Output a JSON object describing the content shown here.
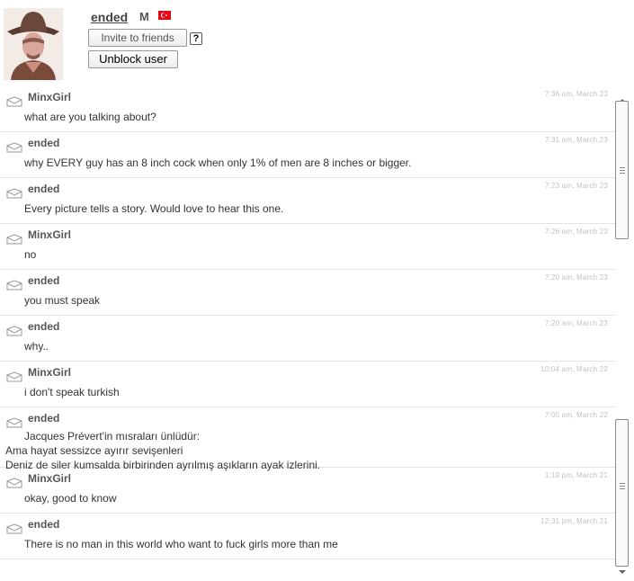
{
  "profile": {
    "username": "ended",
    "gender": "M",
    "invite_label": "Invite to friends",
    "help_label": "?",
    "unblock_label": "Unblock user",
    "flag_color": "#e30a17",
    "avatar_icon": "profile-photo-cowboy"
  },
  "messages": [
    {
      "sender": "MinxGirl",
      "time": "7:36 am, March 23",
      "lines": [
        "what are you talking about?"
      ]
    },
    {
      "sender": "ended",
      "time": "7:31 am, March 23",
      "lines": [
        "why EVERY guy has an 8 inch cock when only 1% of men are 8 inches or bigger."
      ]
    },
    {
      "sender": "ended",
      "time": "7:23 am, March 23",
      "lines": [
        "Every picture tells a story. Would love to hear this one."
      ]
    },
    {
      "sender": "MinxGirl",
      "time": "7:26 am, March 23",
      "lines": [
        "no"
      ]
    },
    {
      "sender": "ended",
      "time": "7:20 am, March 23",
      "lines": [
        "you must speak"
      ]
    },
    {
      "sender": "ended",
      "time": "7:20 am, March 23",
      "lines": [
        "why.."
      ]
    },
    {
      "sender": "MinxGirl",
      "time": "10:04 am, March 22",
      "lines": [
        "i don't speak turkish"
      ]
    },
    {
      "sender": "ended",
      "time": "7:05 am, March 22",
      "lines": [
        "Jacques Prévert'in mısraları ünlüdür:",
        "Ama hayat sessizce ayırır sevişenleri",
        "Deniz de siler kumsalda birbirinden ayrılmış aşıkların ayak izlerini."
      ]
    },
    {
      "sender": "MinxGirl",
      "time": "1:19 pm, March 21",
      "lines": [
        "okay, good to know"
      ]
    },
    {
      "sender": "ended",
      "time": "12:31 pm, March 21",
      "lines": [
        "There is no man in this world who want to fuck girls more than me"
      ]
    }
  ]
}
